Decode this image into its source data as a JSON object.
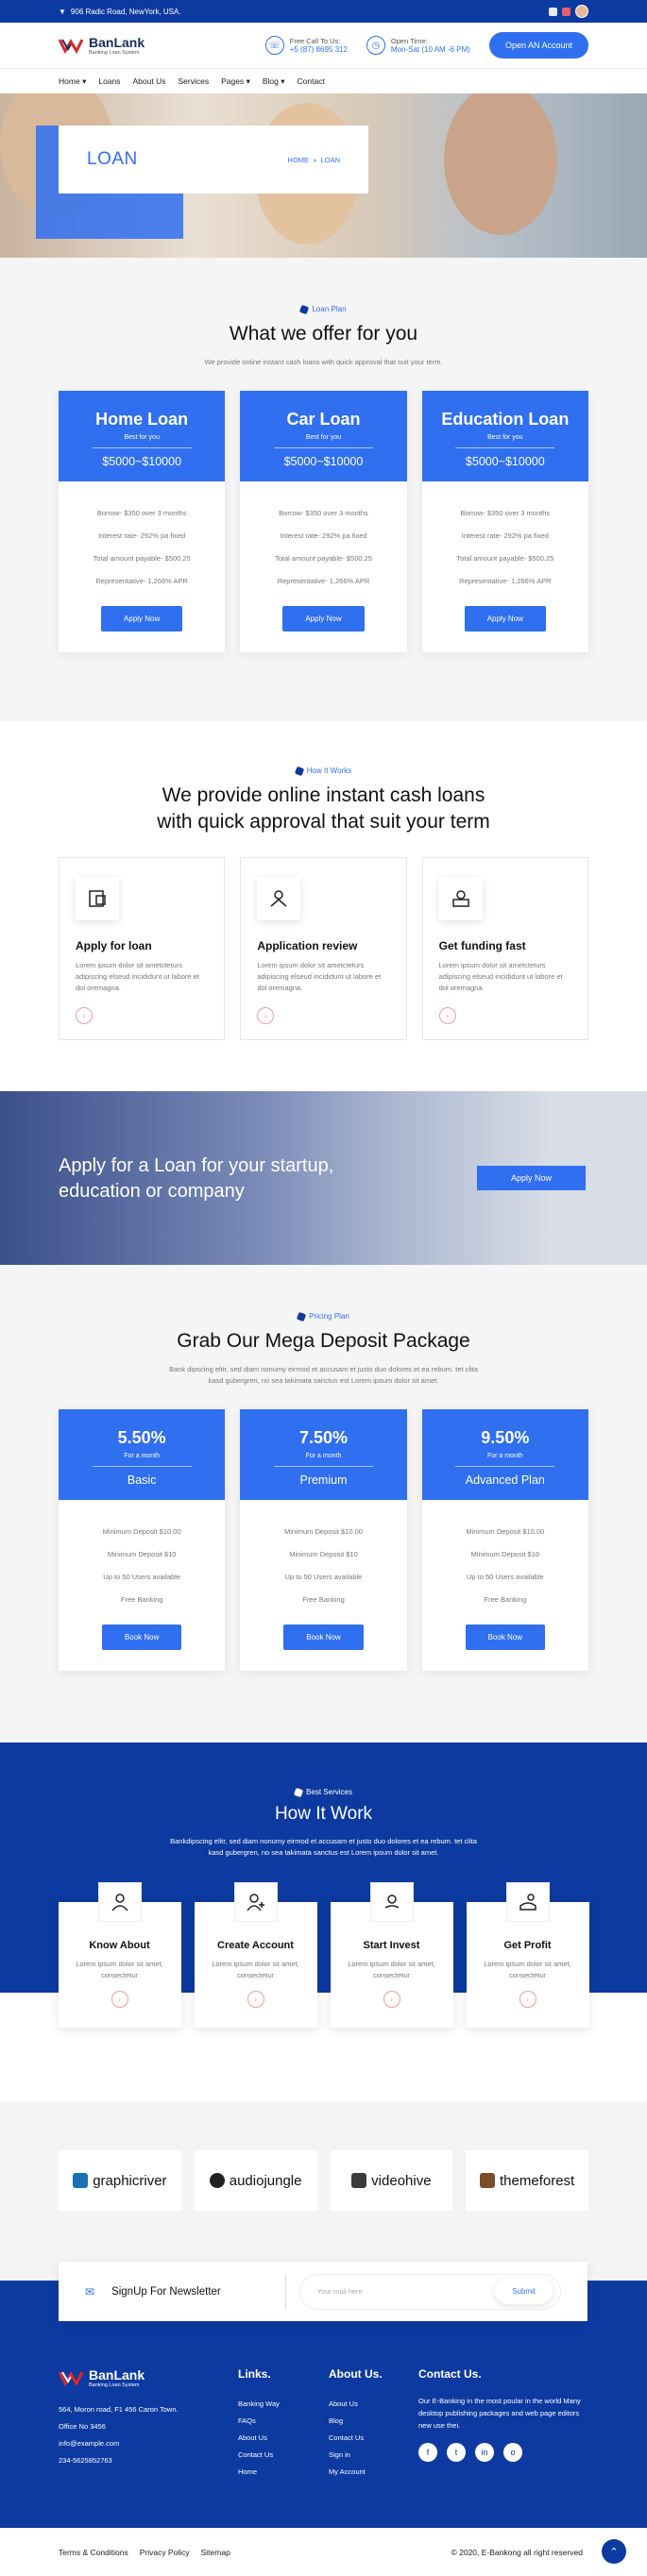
{
  "topbar": {
    "address": "906 Radic Road, NewYork, USA."
  },
  "header": {
    "brand": "BanLank",
    "brand_sub": "Banking Loan System",
    "call_label": "Free Call To Us:",
    "call_value": "+5 (87) 8695 312",
    "time_label": "Open Time:",
    "time_value": "Mon-Sat (10 AM -6 PM)",
    "cta": "Open AN Account"
  },
  "nav": [
    "Home",
    "Loans",
    "About Us",
    "Services",
    "Pages",
    "Blog",
    "Contact"
  ],
  "nav_dropdowns": [
    "Home",
    "Pages",
    "Blog"
  ],
  "hero": {
    "title": "LOAN",
    "crumb_home": "HOME",
    "crumb_sep": "»",
    "crumb_current": "LOAN"
  },
  "loanplan": {
    "kicker": "Loan Plan",
    "title": "What we offer for you",
    "lead": "We provide online instant cash loans with quick approval that suit your term.",
    "cards": [
      {
        "title": "Home Loan",
        "sub": "Best for you",
        "range": "$5000~$10000"
      },
      {
        "title": "Car Loan",
        "sub": "Best for you",
        "range": "$5000~$10000"
      },
      {
        "title": "Education Loan",
        "sub": "Best for you",
        "range": "$5000~$10000"
      }
    ],
    "rows": [
      "Borrow- $350 over 3 months",
      "Interest rate- 292% pa fixed",
      "Total amount payable- $500.25",
      "Representative- 1,266% APR"
    ],
    "button": "Apply Now"
  },
  "how": {
    "kicker": "How It Works",
    "title_line1": "We provide online instant cash loans",
    "title_line2": "with quick approval that suit your term",
    "cards": [
      {
        "title": "Apply for loan",
        "text": "Lorem ipsum dolor sit ametcteturs adipiscing elseud incididunt ut labore et dol oremagna.",
        "icon": "form-icon"
      },
      {
        "title": "Application review",
        "text": "Lorem ipsum dolor sit ametcteturs adipiscing elseud incididunt ut labore et dol oremagna.",
        "icon": "review-icon"
      },
      {
        "title": "Get funding fast",
        "text": "Lorem ipsum dolor sit ametcteturs adipiscing elseud incididunt ut labore et dol oremagna.",
        "icon": "funding-icon"
      }
    ]
  },
  "banner": {
    "line1": "Apply for a Loan for your startup,",
    "line2": "education or company",
    "button": "Apply Now"
  },
  "pricing": {
    "kicker": "Pricing Plan",
    "title": "Grab Our Mega Deposit Package",
    "lead1": "Bank dipscing elitr, sed diam nonumy eirmod et accusam et justo duo dolores et ea rebum. tet clita",
    "lead2": "kasd gubergren, no sea takimata sanctus est Lorem ipsum dolor sit amet.",
    "cards": [
      {
        "rate": "5.50%",
        "sub": "For a month",
        "name": "Basic",
        "min": "Minimum Deposit $10.00"
      },
      {
        "rate": "7.50%",
        "sub": "For a month",
        "name": "Premium",
        "min": "Minimum Deposit $10.00"
      },
      {
        "rate": "9.50%",
        "sub": "For a month",
        "name": "Advanced Plan",
        "min": "Minimum Deposit $10.00"
      }
    ],
    "rows": [
      "Minimum Deposit $10",
      "Up to 50 Users available",
      "Free Banking"
    ],
    "button": "Book Now"
  },
  "services": {
    "kicker": "Best Services",
    "title": "How It Work",
    "lead1": "Bankdipscing elitr, sed diam nonumy eirmod et accusam et justo duo dolores et ea rebum. tet clita",
    "lead2": "kasd gubergren, no sea takimata sanctus est Lorem ipsum dolor sit amet.",
    "cards": [
      {
        "title": "Know About",
        "text": "Lorem ipsum dolor sit amet, consectetur"
      },
      {
        "title": "Create Account",
        "text": "Lorem ipsum dolor sit amet, consectetur"
      },
      {
        "title": "Start Invest",
        "text": "Lorem ipsum dolor sit amet, consectetur"
      },
      {
        "title": "Get Profit",
        "text": "Lorem ipsum dolor sit amet, consectetur"
      }
    ]
  },
  "partners": [
    "graphicriver",
    "audiojungle",
    "videohive",
    "themeforest"
  ],
  "newsletter": {
    "label": "SignUp For Newsletter",
    "placeholder": "Your mail here",
    "button": "Submit"
  },
  "footer": {
    "brand": "BanLank",
    "brand_sub": "Banking Loan System",
    "address": "564, Moron road, F1 456 Caron Town.",
    "office": "Office No 3456",
    "email": "info@example.com",
    "phone": "234-5625852763",
    "links_title": "Links.",
    "links": [
      "Banking Way",
      "FAQs",
      "About Us",
      "Contact Us",
      "Home"
    ],
    "about_title": "About Us.",
    "about": [
      "About Us",
      "Blog",
      "Contact Us",
      "Sign in",
      "My Account"
    ],
    "contact_title": "Contact Us.",
    "contact_text": "Our E-Banking in the most poular in the world Many desktop publishing packages and web page editors new use thei.",
    "social": [
      "f",
      "t",
      "in",
      "o"
    ]
  },
  "bottom": {
    "links": [
      "Terms & Conditions",
      "Privacy Policy",
      "Sitemap"
    ],
    "copyright": "© 2020, E-Bankong all right reserved"
  }
}
